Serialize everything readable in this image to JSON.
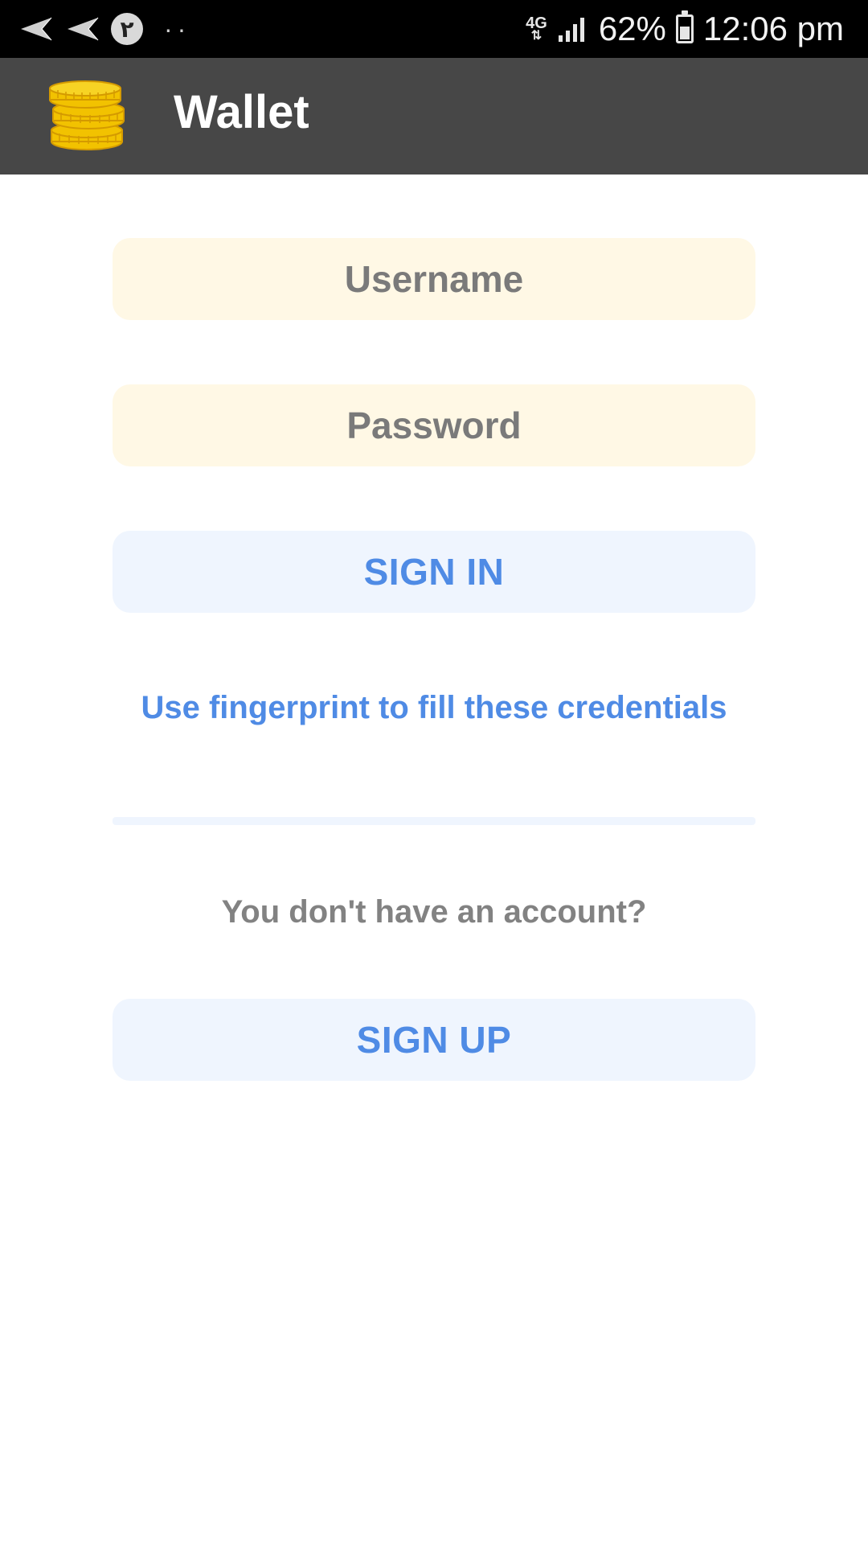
{
  "status_bar": {
    "notification_badge": "٢",
    "overflow_dots": "··",
    "network": "4G",
    "battery_percent": "62%",
    "battery_level": 0.62,
    "time": "12:06 pm",
    "icons": [
      "send-icon",
      "send-icon",
      "signal-icon",
      "battery-icon"
    ]
  },
  "app_bar": {
    "title": "Wallet",
    "logo_icon": "coins-stack-icon",
    "background": "#474747"
  },
  "form": {
    "username_placeholder": "Username",
    "password_placeholder": "Password",
    "sign_in_label": "SIGN IN",
    "fingerprint_link": "Use fingerprint to fill these credentials",
    "no_account_text": "You don't have an account?",
    "sign_up_label": "SIGN UP"
  },
  "colors": {
    "input_bg": "#fff8e5",
    "button_bg": "#eff5fe",
    "accent": "#4f8be5",
    "muted_text": "#7a7a7a"
  }
}
